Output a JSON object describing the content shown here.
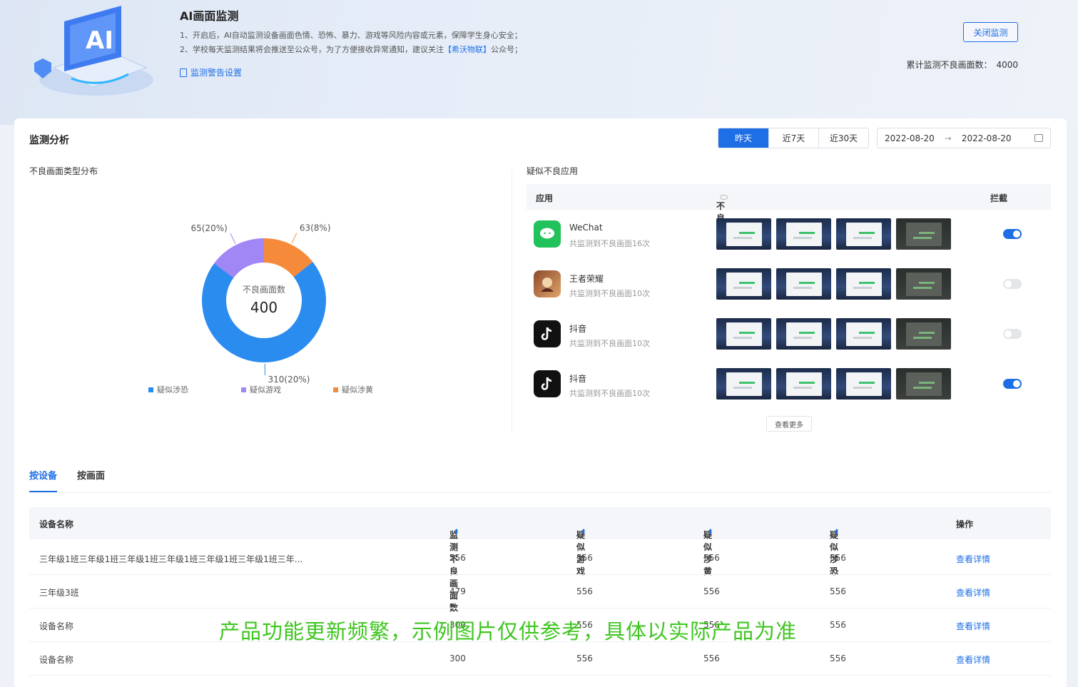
{
  "header": {
    "title": "AI画面监测",
    "line1": "1、开启后，AI自动监测设备画面色情、恐怖、暴力、游戏等风险内容或元素，保障学生身心安全；",
    "line2_prefix": "2、学校每天监测结果将会推送至公众号，为了方便接收异常通知，建议关注",
    "line2_highlight": "【希沃物联】",
    "line2_suffix": "公众号；",
    "warn_link": "监测警告设置",
    "close_button": "关闭监测",
    "total_label": "累计监测不良画面数：",
    "total_value": "4000"
  },
  "analysis": {
    "title": "监测分析",
    "periods": [
      "昨天",
      "近7天",
      "近30天"
    ],
    "active_period": "昨天",
    "date_start": "2022-08-20",
    "date_arrow": "→",
    "date_end": "2022-08-20",
    "distribution_title": "不良画面类型分布",
    "apps_title": "疑似不良应用"
  },
  "chart_data": {
    "type": "pie",
    "center_label": "不良画面数",
    "center_value": "400",
    "labels": [
      "疑似涉恐",
      "疑似游戏",
      "疑似涉黄"
    ],
    "values": [
      310,
      65,
      63
    ],
    "data_labels": [
      "310(20%)",
      "65(20%)",
      "63(8%)"
    ],
    "colors": [
      "#2b8cf0",
      "#a186f5",
      "#f68a3b"
    ],
    "legend_position": "bottom"
  },
  "apps": {
    "headers": {
      "app": "应用",
      "bad": "不良画面",
      "block": "拦截"
    },
    "rows": [
      {
        "name": "WeChat",
        "count": "共监测到不良画面16次",
        "blocked": true,
        "icon": "wechat-icon"
      },
      {
        "name": "王者荣耀",
        "count": "共监测到不良画面10次",
        "blocked": false,
        "icon": "game-icon"
      },
      {
        "name": "抖音",
        "count": "共监测到不良画面10次",
        "blocked": false,
        "icon": "tiktok-icon"
      },
      {
        "name": "抖音",
        "count": "共监测到不良画面10次",
        "blocked": true,
        "icon": "tiktok-icon"
      }
    ],
    "more": "查看更多"
  },
  "tabs": [
    "按设备",
    "按画面"
  ],
  "table": {
    "headers": [
      "设备名称",
      "监测不良画面数",
      "疑似游戏",
      "疑似涉黄",
      "疑似涉恐",
      "操作"
    ],
    "rows": [
      [
        "三年级1班三年级1班三年级1班三年级1班三年级1班三年级1班三年...",
        "556",
        "556",
        "556",
        "556",
        "查看详情"
      ],
      [
        "三年级3班",
        "479",
        "556",
        "556",
        "556",
        "查看详情"
      ],
      [
        "设备名称",
        "300",
        "556",
        "556",
        "556",
        "查看详情"
      ],
      [
        "设备名称",
        "300",
        "556",
        "556",
        "556",
        "查看详情"
      ]
    ]
  },
  "notice": "产品功能更新频繁，示例图片仅供参考，具体以实际产品为准"
}
